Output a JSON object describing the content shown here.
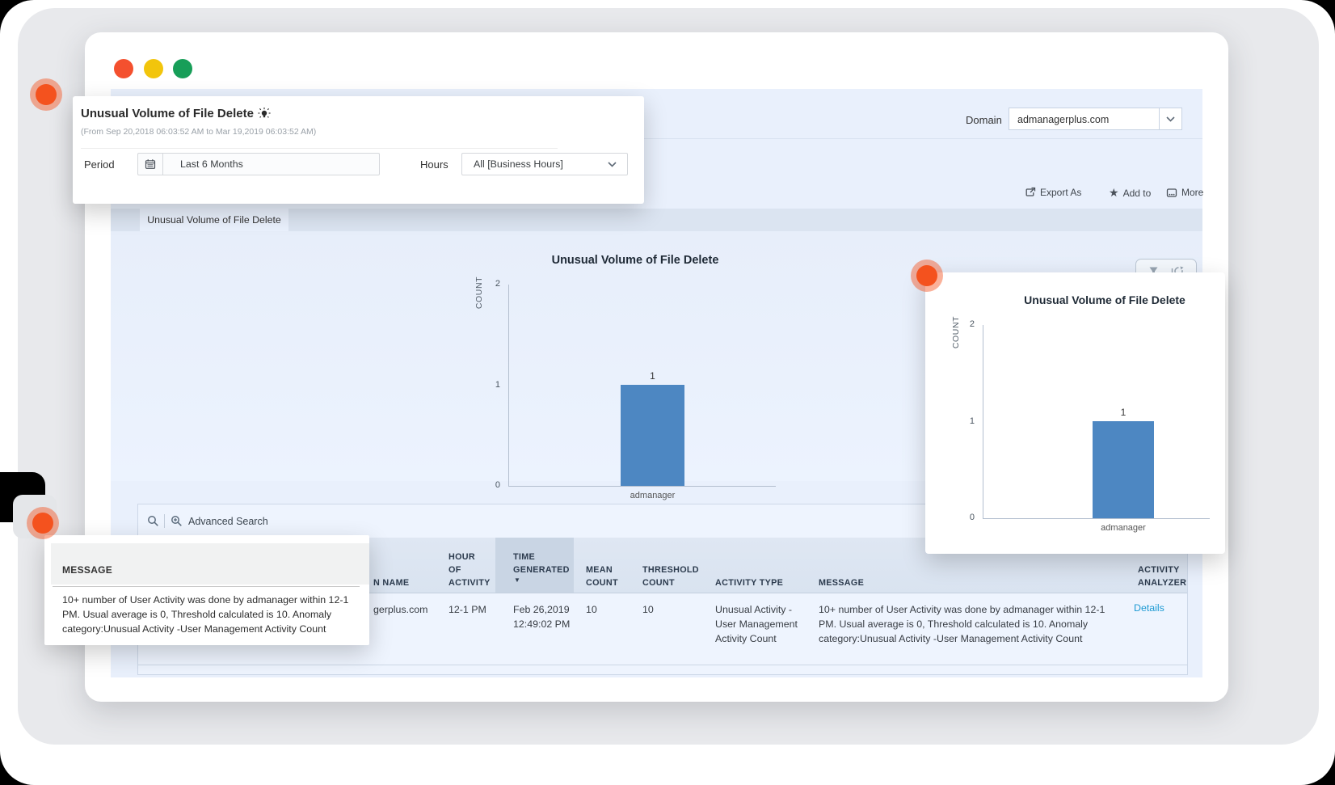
{
  "colors": {
    "bar": "#4d87c2",
    "details_link": "#1d9ad3",
    "marker_orange": "#f4521e",
    "traffic": [
      "#f4502e",
      "#f2c50c",
      "#179e58"
    ]
  },
  "domain_bar": {
    "label": "Domain",
    "value": "admanagerplus.com"
  },
  "toolbar": {
    "export_as": "Export As",
    "add_to": "Add to",
    "more": "More",
    "star_glyph": "★"
  },
  "tabs": {
    "active_label": "Unusual Volume of File Delete"
  },
  "report_card": {
    "title": "Unusual Volume of File Delete",
    "date_range": "(From Sep 20,2018 06:03:52 AM to Mar 19,2019 06:03:52 AM)",
    "period_label": "Period",
    "period_value": "Last 6 Months",
    "hours_label": "Hours",
    "hours_value": "All [Business Hours]"
  },
  "chart_data": [
    {
      "type": "bar",
      "context": "main-report-chart",
      "title": "Unusual Volume of File Delete",
      "xlabel": "",
      "ylabel": "COUNT",
      "categories": [
        "admanager"
      ],
      "values": [
        1
      ],
      "bar_labels": [
        "1"
      ],
      "yticks": [
        0,
        1,
        2
      ],
      "ylim": [
        0,
        2
      ],
      "bar_color": "#4d87c2",
      "grid": false,
      "legend": "none"
    },
    {
      "type": "bar",
      "context": "zoom-callout-chart",
      "title": "Unusual Volume of File Delete",
      "xlabel": "",
      "ylabel": "COUNT",
      "categories": [
        "admanager"
      ],
      "values": [
        1
      ],
      "bar_labels": [
        "1"
      ],
      "yticks": [
        0,
        1,
        2
      ],
      "ylim": [
        0,
        2
      ],
      "bar_color": "#4d87c2",
      "grid": false,
      "legend": "none"
    }
  ],
  "search": {
    "advanced_label": "Advanced Search"
  },
  "table": {
    "headers": [
      "N NAME",
      "HOUR OF ACTIVITY",
      "TIME GENERATED",
      "MEAN COUNT",
      "THRESHOLD COUNT",
      "ACTIVITY TYPE",
      "MESSAGE",
      "ACTIVITY ANALYZER"
    ],
    "sorted_column": "TIME GENERATED",
    "sort_arrow_glyph": "▼",
    "row": {
      "domain_name": "gerplus.com",
      "hour_of_activity": "12-1 PM",
      "time_generated": "Feb 26,2019 12:49:02 PM",
      "mean_count": "10",
      "threshold_count": "10",
      "activity_type": "Unusual Activity -User Management Activity Count",
      "message": "10+ number of User Activity was done by admanager within 12-1 PM. Usual average is 0, Threshold calculated is 10. Anomaly category:Unusual Activity -User Management Activity Count",
      "activity_analyzer": "Details"
    }
  },
  "message_callout": {
    "header": "MESSAGE",
    "body": "10+ number of User Activity was done by admanager within 12-1 PM. Usual average is 0, Threshold calculated is 10. Anomaly category:Unusual Activity -User Management Activity Count"
  }
}
